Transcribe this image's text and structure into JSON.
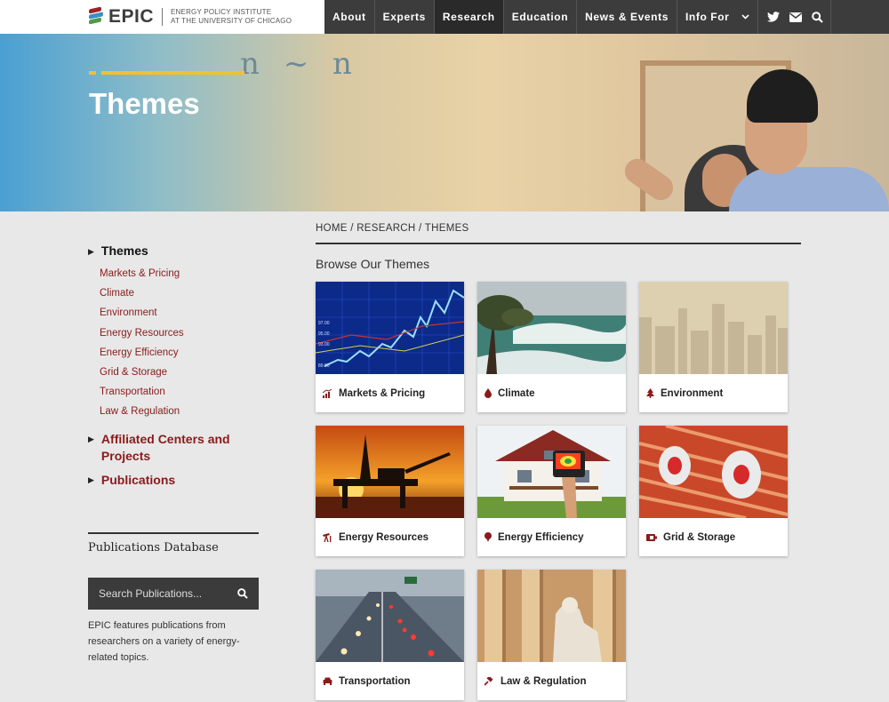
{
  "header": {
    "logo_word": "EPIC",
    "logo_sub_line1": "ENERGY POLICY INSTITUTE",
    "logo_sub_line2": "AT THE UNIVERSITY OF CHICAGO",
    "nav": [
      "About",
      "Experts",
      "Research",
      "Education",
      "News & Events",
      "Info For"
    ],
    "active_nav": "Research",
    "icons": [
      "twitter-icon",
      "mail-icon",
      "search-icon"
    ]
  },
  "hero": {
    "title": "Themes",
    "accent_color": "#f2c12e"
  },
  "breadcrumb": [
    "HOME",
    "RESEARCH",
    "THEMES"
  ],
  "browse_title": "Browse Our Themes",
  "sidebar": {
    "current_section": "Themes",
    "themes": [
      "Markets & Pricing",
      "Climate",
      "Environment",
      "Energy Resources",
      "Energy Efficiency",
      "Grid & Storage",
      "Transportation",
      "Law & Regulation"
    ],
    "affiliated": "Affiliated Centers and Projects",
    "publications": "Publications",
    "link_color": "#8b1a1a"
  },
  "publications_db": {
    "title": "Publications Database",
    "search_placeholder": "Search Publications...",
    "description": "EPIC features publications from researchers on a variety of energy-related topics."
  },
  "cards": [
    {
      "label": "Markets & Pricing",
      "icon": "chart-icon"
    },
    {
      "label": "Climate",
      "icon": "drop-icon"
    },
    {
      "label": "Environment",
      "icon": "tree-icon"
    },
    {
      "label": "Energy Resources",
      "icon": "oil-pump-icon"
    },
    {
      "label": "Energy Efficiency",
      "icon": "pin-icon"
    },
    {
      "label": "Grid & Storage",
      "icon": "battery-icon"
    },
    {
      "label": "Transportation",
      "icon": "car-icon"
    },
    {
      "label": "Law & Regulation",
      "icon": "gavel-icon"
    }
  ]
}
